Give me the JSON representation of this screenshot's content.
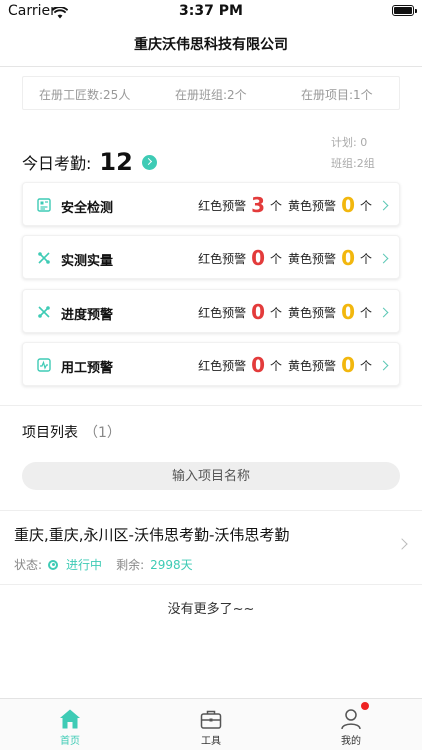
{
  "status_bar": {
    "carrier": "Carrier",
    "time": "3:37 PM"
  },
  "nav": {
    "title": "重庆沃伟思科技有限公司"
  },
  "stats": {
    "workers": "在册工匠数:25人",
    "teams": "在册班组:2个",
    "projects": "在册项目:1个"
  },
  "plan": {
    "plan": "计划: 0",
    "team": "班组:2组"
  },
  "attendance": {
    "label": "今日考勤:",
    "count": "12"
  },
  "warnings": [
    {
      "name": "安全检测",
      "icon": "safety-check-icon",
      "red_label": "红色预警",
      "red_value": "3",
      "unit1": "个",
      "yellow_label": "黄色预警",
      "yellow_value": "0",
      "unit2": "个"
    },
    {
      "name": "实测实量",
      "icon": "measure-icon",
      "red_label": "红色预警",
      "red_value": "0",
      "unit1": "个",
      "yellow_label": "黄色预警",
      "yellow_value": "0",
      "unit2": "个"
    },
    {
      "name": "进度预警",
      "icon": "progress-icon",
      "red_label": "红色预警",
      "red_value": "0",
      "unit1": "个",
      "yellow_label": "黄色预警",
      "yellow_value": "0",
      "unit2": "个"
    },
    {
      "name": "用工预警",
      "icon": "labor-chart-icon",
      "red_label": "红色预警",
      "red_value": "0",
      "unit1": "个",
      "yellow_label": "黄色预警",
      "yellow_value": "0",
      "unit2": "个"
    }
  ],
  "project_list": {
    "title": "项目列表",
    "count": "（1）",
    "search_placeholder": "输入项目名称",
    "items": [
      {
        "name": "重庆,重庆,永川区-沃伟思考勤-沃伟思考勤",
        "status_label": "状态:",
        "status": "进行中",
        "remain_label": "剩余:",
        "remain": "2998天"
      }
    ],
    "no_more": "没有更多了~~"
  },
  "tabs": [
    {
      "label": "首页",
      "icon": "home-icon",
      "active": true
    },
    {
      "label": "工具",
      "icon": "toolbox-icon",
      "active": false
    },
    {
      "label": "我的",
      "icon": "user-icon",
      "active": false
    }
  ],
  "colors": {
    "accent": "#3ecbb5",
    "red": "#e33b3b",
    "yellow": "#f2b70e"
  }
}
